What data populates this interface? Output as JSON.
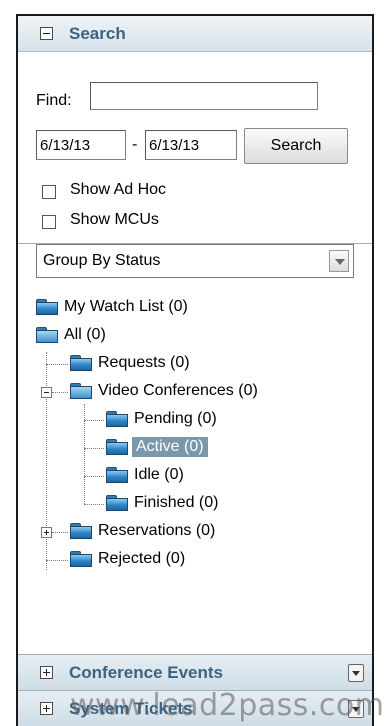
{
  "search_panel": {
    "title": "Search",
    "find_label": "Find:",
    "find_value": "",
    "date_from": "6/13/13",
    "date_separator": "-",
    "date_to": "6/13/13",
    "search_button": "Search",
    "show_adhoc_label": "Show Ad Hoc",
    "show_mcus_label": "Show MCUs",
    "show_adhoc_checked": false,
    "show_mcus_checked": false
  },
  "group_by": {
    "selected": "Group By Status"
  },
  "tree": {
    "my_watch_list": "My Watch List (0)",
    "all": "All (0)",
    "requests": "Requests (0)",
    "video_conferences": "Video Conferences (0)",
    "pending": "Pending (0)",
    "active": "Active (0)",
    "idle": "Idle (0)",
    "finished": "Finished (0)",
    "reservations": "Reservations (0)",
    "rejected": "Rejected (0)"
  },
  "footer_panels": {
    "conference_events": "Conference Events",
    "system_tickets": "System Tickets"
  },
  "watermark": "www.lead2pass.com",
  "colors": {
    "header_title": "#3c6384",
    "selection_bg": "#7a98ab"
  },
  "icons": [
    "collapse-icon",
    "expand-icon",
    "folder-icon",
    "folder-open-icon",
    "dropdown-arrow-icon",
    "panel-menu-icon"
  ]
}
